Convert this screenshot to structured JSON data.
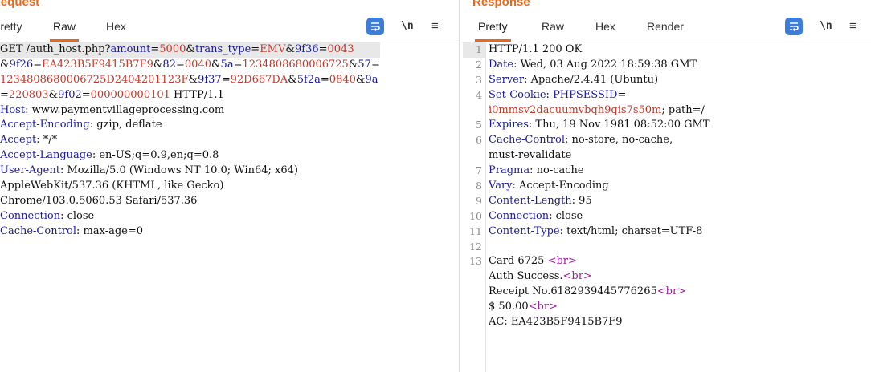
{
  "request": {
    "title": "Request",
    "tabs": [
      "Pretty",
      "Raw",
      "Hex"
    ],
    "active_tab": "Raw",
    "toolbar": {
      "wrap_icon": "wrap-lines-icon",
      "newline_label": "\\n",
      "menu_icon": "≡"
    },
    "lines": [
      [
        {
          "t": "GET /auth_host.php?",
          "c": "plain"
        },
        {
          "t": "amount",
          "c": "pn"
        },
        {
          "t": "=",
          "c": "plain"
        },
        {
          "t": "5000",
          "c": "pv"
        },
        {
          "t": "&",
          "c": "plain"
        },
        {
          "t": "trans_type",
          "c": "pn"
        },
        {
          "t": "=",
          "c": "plain"
        },
        {
          "t": "EMV",
          "c": "pv"
        },
        {
          "t": "&",
          "c": "plain"
        },
        {
          "t": "9f36",
          "c": "pn"
        },
        {
          "t": "=",
          "c": "plain"
        },
        {
          "t": "0043",
          "c": "pv"
        }
      ],
      [
        {
          "t": "&",
          "c": "plain"
        },
        {
          "t": "9f26",
          "c": "pn"
        },
        {
          "t": "=",
          "c": "plain"
        },
        {
          "t": "EA423B5F9415B7F9",
          "c": "pv"
        },
        {
          "t": "&",
          "c": "plain"
        },
        {
          "t": "82",
          "c": "pn"
        },
        {
          "t": "=",
          "c": "plain"
        },
        {
          "t": "0040",
          "c": "pv"
        },
        {
          "t": "&",
          "c": "plain"
        },
        {
          "t": "5a",
          "c": "pn"
        },
        {
          "t": "=",
          "c": "plain"
        },
        {
          "t": "1234808680006725",
          "c": "pv"
        },
        {
          "t": "&",
          "c": "plain"
        },
        {
          "t": "57",
          "c": "pn"
        },
        {
          "t": "=",
          "c": "plain"
        }
      ],
      [
        {
          "t": "1234808680006725D2404201123F",
          "c": "pv"
        },
        {
          "t": "&",
          "c": "plain"
        },
        {
          "t": "9f37",
          "c": "pn"
        },
        {
          "t": "=",
          "c": "plain"
        },
        {
          "t": "92D667DA",
          "c": "pv"
        },
        {
          "t": "&",
          "c": "plain"
        },
        {
          "t": "5f2a",
          "c": "pn"
        },
        {
          "t": "=",
          "c": "plain"
        },
        {
          "t": "0840",
          "c": "pv"
        },
        {
          "t": "&",
          "c": "plain"
        },
        {
          "t": "9a",
          "c": "pn"
        }
      ],
      [
        {
          "t": "=",
          "c": "plain"
        },
        {
          "t": "220803",
          "c": "pv"
        },
        {
          "t": "&",
          "c": "plain"
        },
        {
          "t": "9f02",
          "c": "pn"
        },
        {
          "t": "=",
          "c": "plain"
        },
        {
          "t": "000000000101",
          "c": "pv"
        },
        {
          "t": " HTTP/1.1",
          "c": "plain"
        }
      ],
      [
        {
          "t": "Host",
          "c": "hname"
        },
        {
          "t": ": www.paymentvillageprocessing.com",
          "c": "plain"
        }
      ],
      [
        {
          "t": "Accept-Encoding",
          "c": "hname"
        },
        {
          "t": ": gzip, deflate",
          "c": "plain"
        }
      ],
      [
        {
          "t": "Accept",
          "c": "hname"
        },
        {
          "t": ": */*",
          "c": "plain"
        }
      ],
      [
        {
          "t": "Accept-Language",
          "c": "hname"
        },
        {
          "t": ": en-US;q=0.9,en;q=0.8",
          "c": "plain"
        }
      ],
      [
        {
          "t": "User-Agent",
          "c": "hname"
        },
        {
          "t": ": Mozilla/5.0 (Windows NT 10.0; Win64; x64)",
          "c": "plain"
        }
      ],
      [
        {
          "t": "AppleWebKit/537.36 (KHTML, like Gecko)",
          "c": "plain"
        }
      ],
      [
        {
          "t": "Chrome/103.0.5060.53 Safari/537.36",
          "c": "plain"
        }
      ],
      [
        {
          "t": "Connection",
          "c": "hname"
        },
        {
          "t": ": close",
          "c": "plain"
        }
      ],
      [
        {
          "t": "Cache-Control",
          "c": "hname"
        },
        {
          "t": ": max-age=0",
          "c": "plain"
        }
      ]
    ]
  },
  "response": {
    "title": "Response",
    "tabs": [
      "Pretty",
      "Raw",
      "Hex",
      "Render"
    ],
    "active_tab": "Pretty",
    "toolbar": {
      "wrap_icon": "wrap-lines-icon",
      "newline_label": "\\n",
      "menu_icon": "≡"
    },
    "line_numbers": [
      "1",
      "2",
      "3",
      "4",
      "",
      "5",
      "6",
      "",
      "7",
      "8",
      "9",
      "10",
      "11",
      "12",
      "13",
      "",
      "",
      "",
      "",
      ""
    ],
    "lines": [
      [
        {
          "t": "HTTP/1.1 200 OK",
          "c": "plain"
        }
      ],
      [
        {
          "t": "Date",
          "c": "hname"
        },
        {
          "t": ": Wed, 03 Aug 2022 18:59:38 GMT",
          "c": "plain"
        }
      ],
      [
        {
          "t": "Server",
          "c": "hname"
        },
        {
          "t": ": Apache/2.4.41 (Ubuntu)",
          "c": "plain"
        }
      ],
      [
        {
          "t": "Set-Cookie",
          "c": "hname"
        },
        {
          "t": ": ",
          "c": "plain"
        },
        {
          "t": "PHPSESSID",
          "c": "pn"
        },
        {
          "t": "=",
          "c": "plain"
        }
      ],
      [
        {
          "t": "i0mmsv2dacuumvbqh9qis7s50m",
          "c": "cv"
        },
        {
          "t": "; path=/",
          "c": "plain"
        }
      ],
      [
        {
          "t": "Expires",
          "c": "hname"
        },
        {
          "t": ": Thu, 19 Nov 1981 08:52:00 GMT",
          "c": "plain"
        }
      ],
      [
        {
          "t": "Cache-Control",
          "c": "hname"
        },
        {
          "t": ": no-store, no-cache,",
          "c": "plain"
        }
      ],
      [
        {
          "t": "must-revalidate",
          "c": "plain"
        }
      ],
      [
        {
          "t": "Pragma",
          "c": "hname"
        },
        {
          "t": ": no-cache",
          "c": "plain"
        }
      ],
      [
        {
          "t": "Vary",
          "c": "hname"
        },
        {
          "t": ": Accept-Encoding",
          "c": "plain"
        }
      ],
      [
        {
          "t": "Content-Length",
          "c": "hname"
        },
        {
          "t": ": 95",
          "c": "plain"
        }
      ],
      [
        {
          "t": "Connection",
          "c": "hname"
        },
        {
          "t": ": close",
          "c": "plain"
        }
      ],
      [
        {
          "t": "Content-Type",
          "c": "hname"
        },
        {
          "t": ": text/html; charset=UTF-8",
          "c": "plain"
        }
      ],
      [
        {
          "t": "",
          "c": "plain"
        }
      ],
      [
        {
          "t": "Card 6725 ",
          "c": "plain"
        },
        {
          "t": "<br>",
          "c": "tg"
        }
      ],
      [
        {
          "t": " Auth Success.",
          "c": "plain"
        },
        {
          "t": "<br>",
          "c": "tg"
        }
      ],
      [
        {
          "t": "Receipt No.6182939445776265",
          "c": "plain"
        },
        {
          "t": "<br>",
          "c": "tg"
        }
      ],
      [
        {
          "t": " $ 50.00",
          "c": "plain"
        },
        {
          "t": "<br>",
          "c": "tg"
        }
      ],
      [
        {
          "t": "AC: EA423B5F9415B7F9",
          "c": "plain"
        }
      ]
    ]
  }
}
